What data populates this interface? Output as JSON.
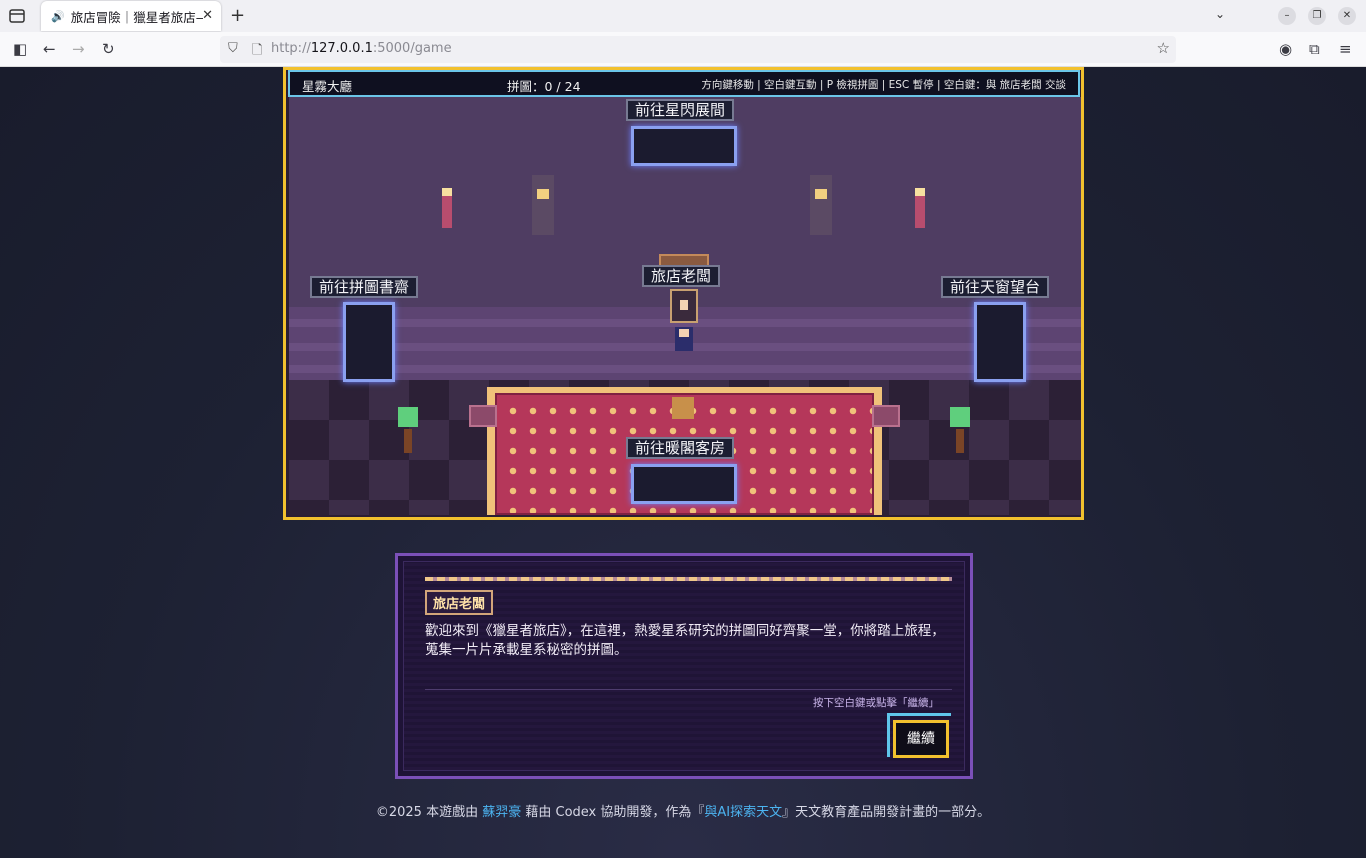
{
  "browser": {
    "tab_title": "旅店冒險｜獵星者旅店—",
    "url_prefix": "http://",
    "url_host": "127.0.0.1",
    "url_rest": ":5000/game",
    "icons": {
      "tab_list": "tab-list-icon",
      "speaker": "speaker-icon",
      "close": "close-icon",
      "new_tab": "plus-icon",
      "back": "back-icon",
      "forward": "forward-icon",
      "reload": "reload-icon",
      "sidebar": "sidebar-icon",
      "shield": "shield-icon",
      "page": "page-icon",
      "bookmark": "star-icon",
      "account": "account-icon",
      "extensions": "puzzle-icon",
      "menu": "hamburger-icon"
    }
  },
  "hud": {
    "location": "星霧大廳",
    "puzzle_counter": "拼圖：0 / 24",
    "help": "方向鍵移動 | 空白鍵互動 | P 檢視拼圖 | ESC 暫停 | 空白鍵：與 旅店老闆 交談"
  },
  "room": {
    "portals": {
      "top": "前往星閃展間",
      "left": "前往拼圖書齋",
      "right": "前往天窗望台",
      "bottom": "前往暖閣客房"
    },
    "npc_label": "旅店老闆"
  },
  "dialog": {
    "speaker": "旅店老闆",
    "text": "歡迎來到《獵星者旅店》，在這裡，熱愛星系研究的拼圖同好齊聚一堂，你將踏上旅程，蒐集一片片承載星系秘密的拼圖。",
    "hint": "按下空白鍵或點擊「繼續」",
    "continue_label": "繼續"
  },
  "footer": {
    "prefix": "©2025 本遊戲由 ",
    "author": "蘇羿豪",
    "middle": " 藉由 Codex 協助開發，作為『",
    "project": "與AI探索天文",
    "suffix": "』天文教育產品開發計畫的一部分。"
  },
  "colors": {
    "frame_gold": "#f2c12e",
    "hud_border": "#6bc5e8",
    "dialog_border": "#7b50b8",
    "link": "#4cb3f0",
    "portal_glow": "#8aa0f0"
  }
}
